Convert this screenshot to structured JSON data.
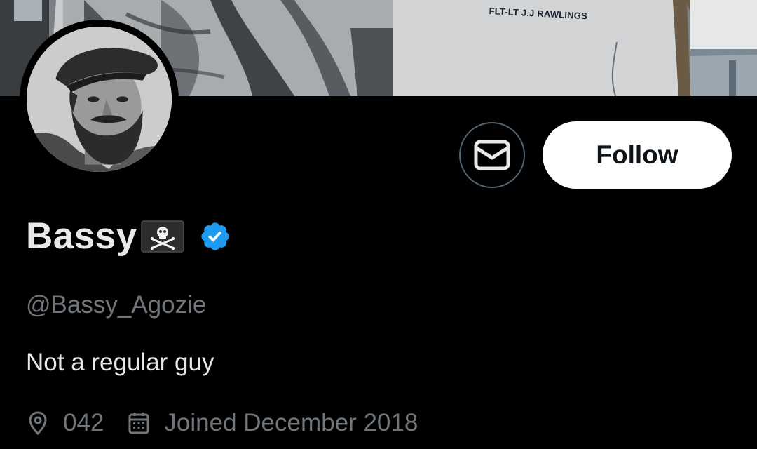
{
  "banner": {
    "caption": "FLT-LT J.J RAWLINGS"
  },
  "profile": {
    "display_name": "Bassy",
    "name_emoji": "pirate-flag-icon",
    "verified": true,
    "handle": "@Bassy_Agozie",
    "bio": "Not a regular guy",
    "location": "042",
    "joined": "Joined December 2018"
  },
  "actions": {
    "message_icon": "envelope-icon",
    "follow_label": "Follow"
  },
  "colors": {
    "background": "#000000",
    "primary_text": "#e7e9ea",
    "secondary_text": "#71767b",
    "verified_blue": "#1d9bf0",
    "button_border": "#536471",
    "follow_bg": "#ffffff",
    "follow_text": "#0f1419"
  },
  "icons": {
    "location": "location-pin-icon",
    "calendar": "calendar-icon",
    "verified": "verified-badge-icon"
  }
}
